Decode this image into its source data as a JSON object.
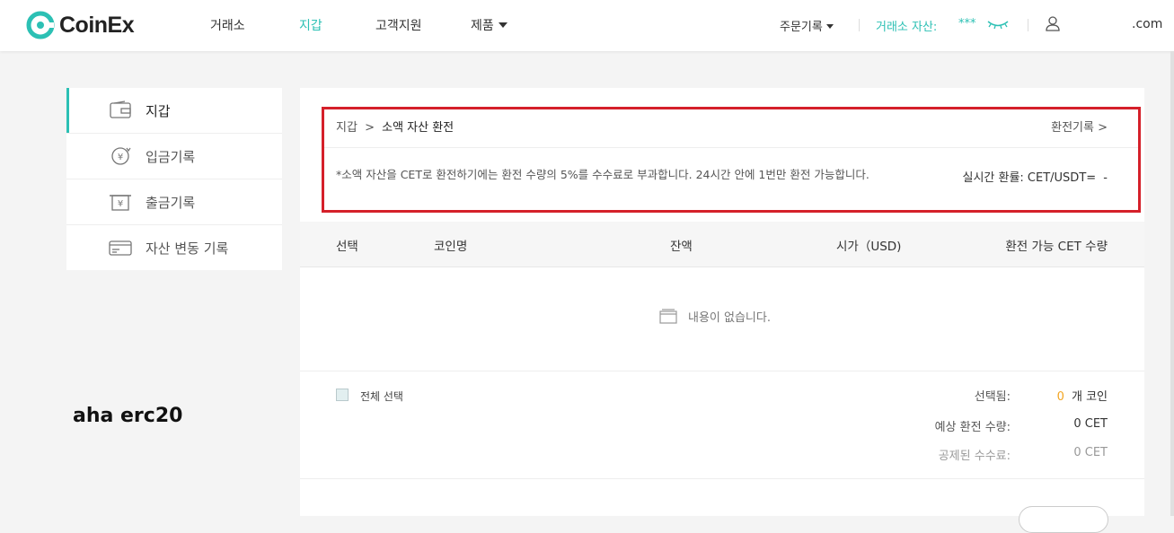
{
  "header": {
    "logo_text": "CoinEx",
    "nav": [
      {
        "label": "거래소"
      },
      {
        "label": "지갑"
      },
      {
        "label": "고객지원"
      },
      {
        "label": "제품"
      }
    ],
    "order_history": "주문기록",
    "assets_label": "거래소 자산:",
    "assets_value": "***",
    "account_suffix": ".com",
    "accent_color": "#2cc0b4"
  },
  "sidebar": {
    "items": [
      {
        "label": "지갑",
        "icon": "wallet-icon"
      },
      {
        "label": "입금기록",
        "icon": "deposit-icon"
      },
      {
        "label": "출금기록",
        "icon": "withdraw-icon"
      },
      {
        "label": "자산 변동 기록",
        "icon": "card-icon"
      }
    ]
  },
  "main": {
    "breadcrumb_root": "지갑",
    "breadcrumb_sep": ">",
    "breadcrumb_current": "소액 자산 환전",
    "history_link": "환전기록 >",
    "notice": "*소액 자산을 CET로 환전하기에는 환전 수량의 5%를 수수료로 부과합니다. 24시간 안에 1번만 환전 가능합니다.",
    "rate_label": "실시간 환률: CET/USDT=",
    "rate_value": "-",
    "table": {
      "columns": [
        "선택",
        "코인명",
        "잔액",
        "시가（USD)",
        "환전 가능 CET 수량"
      ],
      "rows": []
    },
    "empty_text": "내용이 없습니다.",
    "select_all": "전체 선택",
    "summary": {
      "selected_label": "선택됨:",
      "selected_count": "0",
      "selected_unit": "개 코인",
      "expected_label": "예상 환전 수량:",
      "expected_value": "0 CET",
      "fee_label": "공제된 수수료:",
      "fee_value": "0 CET"
    },
    "highlight_color": "#d5202a"
  },
  "annotation": "aha erc20"
}
